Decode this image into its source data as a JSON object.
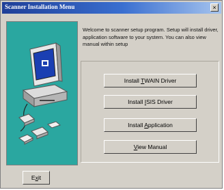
{
  "window": {
    "title": "Scanner Installation Menu",
    "close_label": "×"
  },
  "welcome_text": "Welcome to scanner setup program. Setup will install driver, application software to your system. You can also view manual within setup",
  "buttons": {
    "twain": {
      "pre": "Install ",
      "hot": "T",
      "post": "WAIN Driver"
    },
    "isis": {
      "pre": "Install ",
      "hot": "I",
      "post": "SIS Driver"
    },
    "application": {
      "pre": "Install ",
      "hot": "A",
      "post": "pplication"
    },
    "manual": {
      "pre": "",
      "hot": "V",
      "post": "iew Manual"
    },
    "exit": {
      "pre": "E",
      "hot": "x",
      "post": "it"
    }
  },
  "colors": {
    "title_start": "#1f3f98",
    "panel": "#2aa7a0",
    "face": "#d4d0c8"
  },
  "illustration": {
    "icon": "computer-with-scanner-icon"
  }
}
